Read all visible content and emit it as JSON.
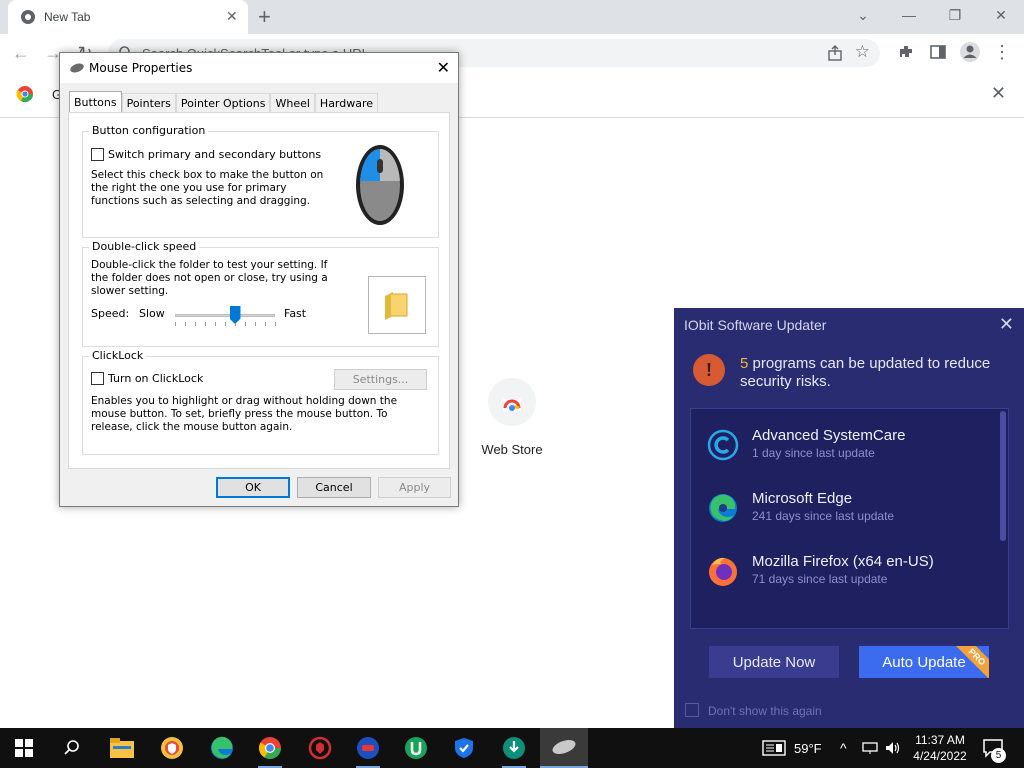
{
  "browser": {
    "tab_title": "New Tab",
    "tab_close": "✕",
    "new_tab": "+",
    "omnibox_placeholder": "Search QuickSearchTool or type a URL",
    "infobar_text": "G",
    "infobar_close": "✕",
    "web_store_label": "Web Store",
    "window_controls": [
      "⌄",
      "—",
      "❐",
      "✕"
    ]
  },
  "mouse_dialog": {
    "title": "Mouse Properties",
    "tabs": [
      "Buttons",
      "Pointers",
      "Pointer Options",
      "Wheel",
      "Hardware"
    ],
    "active_tab": "Buttons",
    "button_config": {
      "title": "Button configuration",
      "switch_label": "Switch primary and secondary buttons",
      "switch_checked": false,
      "description": "Select this check box to make the button on the right the one you use for primary functions such as selecting and dragging."
    },
    "double_click": {
      "title": "Double-click speed",
      "description": "Double-click the folder to test your setting. If the folder does not open or close, try using a slower setting.",
      "speed_label": "Speed:",
      "slow_label": "Slow",
      "fast_label": "Fast",
      "slider_value": 0.6
    },
    "clicklock": {
      "title": "ClickLock",
      "toggle_label": "Turn on ClickLock",
      "checked": false,
      "settings_button": "Settings...",
      "description": "Enables you to highlight or drag without holding down the mouse button. To set, briefly press the mouse button. To release, click the mouse button again."
    },
    "buttons": {
      "ok": "OK",
      "cancel": "Cancel",
      "apply": "Apply"
    }
  },
  "iobit": {
    "title": "IObit Software Updater",
    "count": "5",
    "message": " programs can be updated to reduce security risks.",
    "apps": [
      {
        "name": "Advanced SystemCare",
        "sub": "1 day since last update",
        "icon": "advanced-systemcare-icon"
      },
      {
        "name": "Microsoft Edge",
        "sub": "241 days since last update",
        "icon": "edge-icon"
      },
      {
        "name": "Mozilla Firefox (x64 en-US)",
        "sub": "71 days since last update",
        "icon": "firefox-icon"
      }
    ],
    "update_now": "Update Now",
    "auto_update": "Auto Update",
    "pro_badge": "PRO",
    "dont_show": "Don't show this again"
  },
  "taskbar": {
    "weather": "59°F",
    "time": "11:37 AM",
    "date": "4/24/2022",
    "notification_count": "5"
  },
  "colors": {
    "iobit_bg": "#2a2c72",
    "iobit_accent": "#3b6cf0",
    "dialog_default_border": "#0078d7"
  }
}
